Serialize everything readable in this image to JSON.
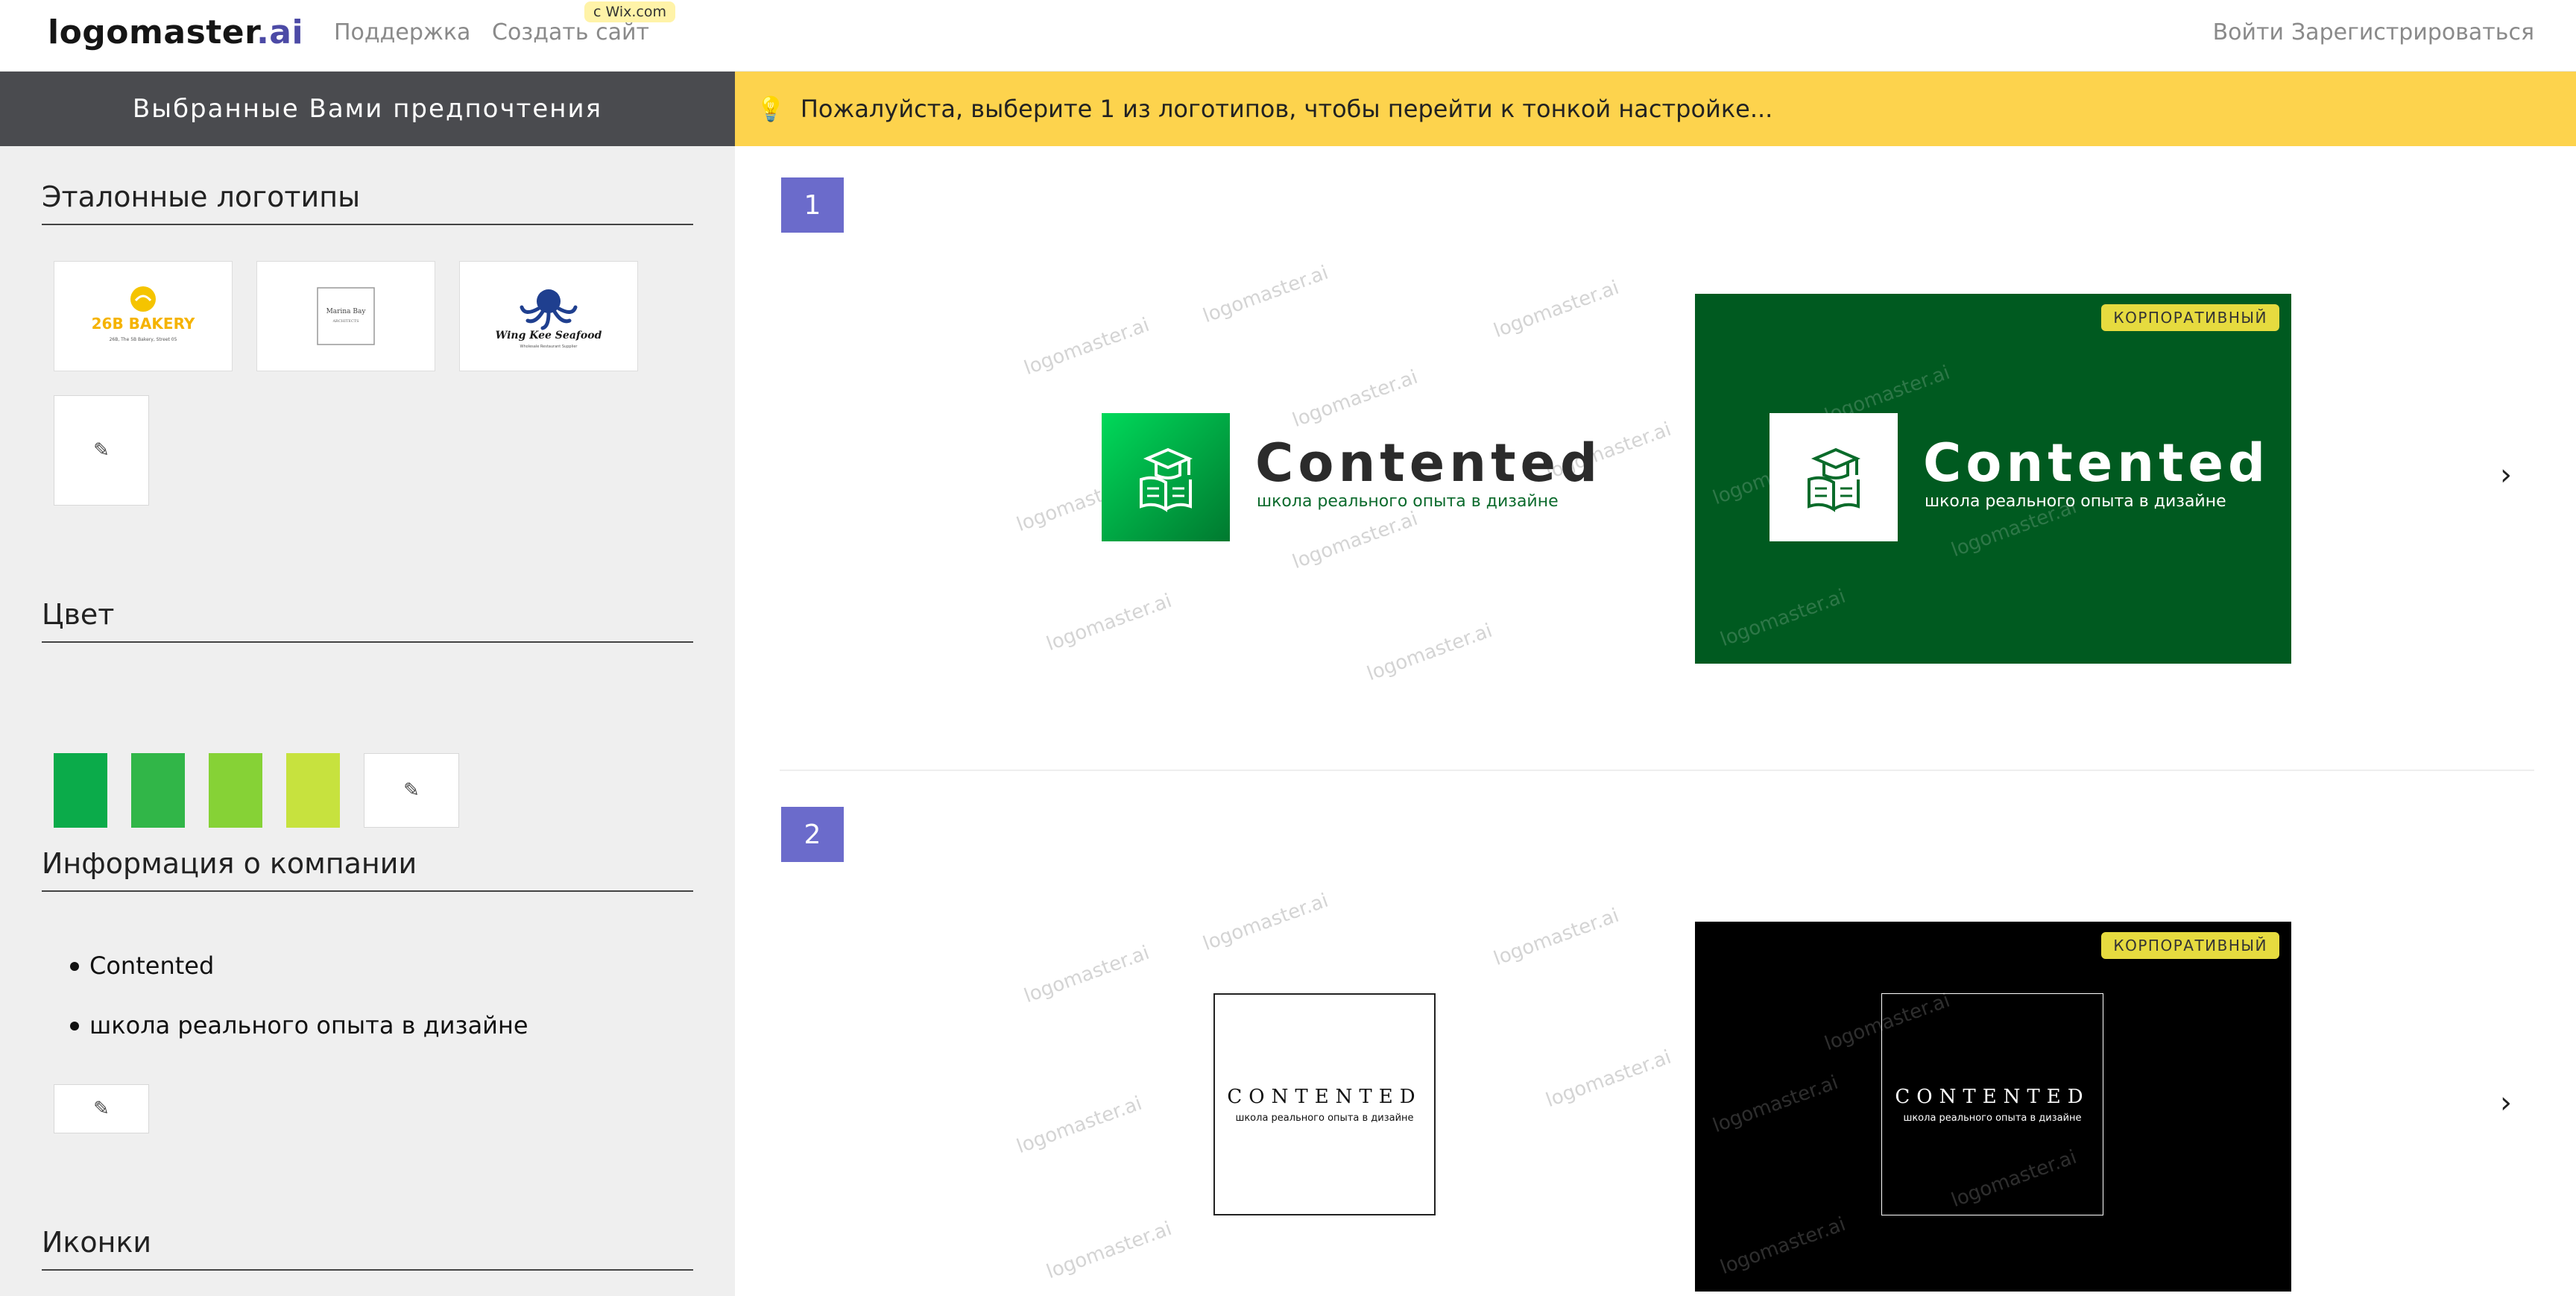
{
  "nav": {
    "brand_main": "logomaster",
    "brand_suffix": ".ai",
    "support": "Поддержка",
    "create_site": "Создать сайт",
    "wix_badge": "c Wix.com",
    "login": "Войти",
    "register": "Зарегистрироваться"
  },
  "sidebar": {
    "header": "Выбранные Вами предпочтения",
    "reference_logos": {
      "title": "Эталонные логотипы",
      "items": [
        {
          "name": "26B BAKERY",
          "sub": "26B, The 5B Bakery, Street 05"
        },
        {
          "name": "Marina Bay",
          "sub": "ARCHITECTS"
        },
        {
          "name": "Wing Kee Seafood",
          "sub": "Wholesale Restaurant Supplier"
        }
      ]
    },
    "color": {
      "title": "Цвет",
      "swatches": [
        "#0bab4a",
        "#31b648",
        "#86d236",
        "#c7e23e"
      ]
    },
    "company_info": {
      "title": "Информация о компании",
      "items": [
        "Contented",
        "школа реального опыта в дизайне"
      ]
    },
    "icons": {
      "title": "Иконки"
    },
    "edit_icon": "✎"
  },
  "banner": {
    "icon": "💡",
    "text": "Пожалуйста, выберите 1 из логотипов, чтобы перейти к тонкой настройке..."
  },
  "results": [
    {
      "number": "1",
      "brand": "Contented",
      "tagline": "школа реального опыта в дизайне",
      "badge": "КОРПОРАТИВНЫЙ",
      "preview_bg": "#005a20"
    },
    {
      "number": "2",
      "brand": "CONTENTED",
      "tagline": "школа реального опыта в дизайне",
      "badge": "КОРПОРАТИВНЫЙ",
      "preview_bg": "#000000"
    }
  ],
  "watermark": "logomaster.ai",
  "chevron": "›"
}
